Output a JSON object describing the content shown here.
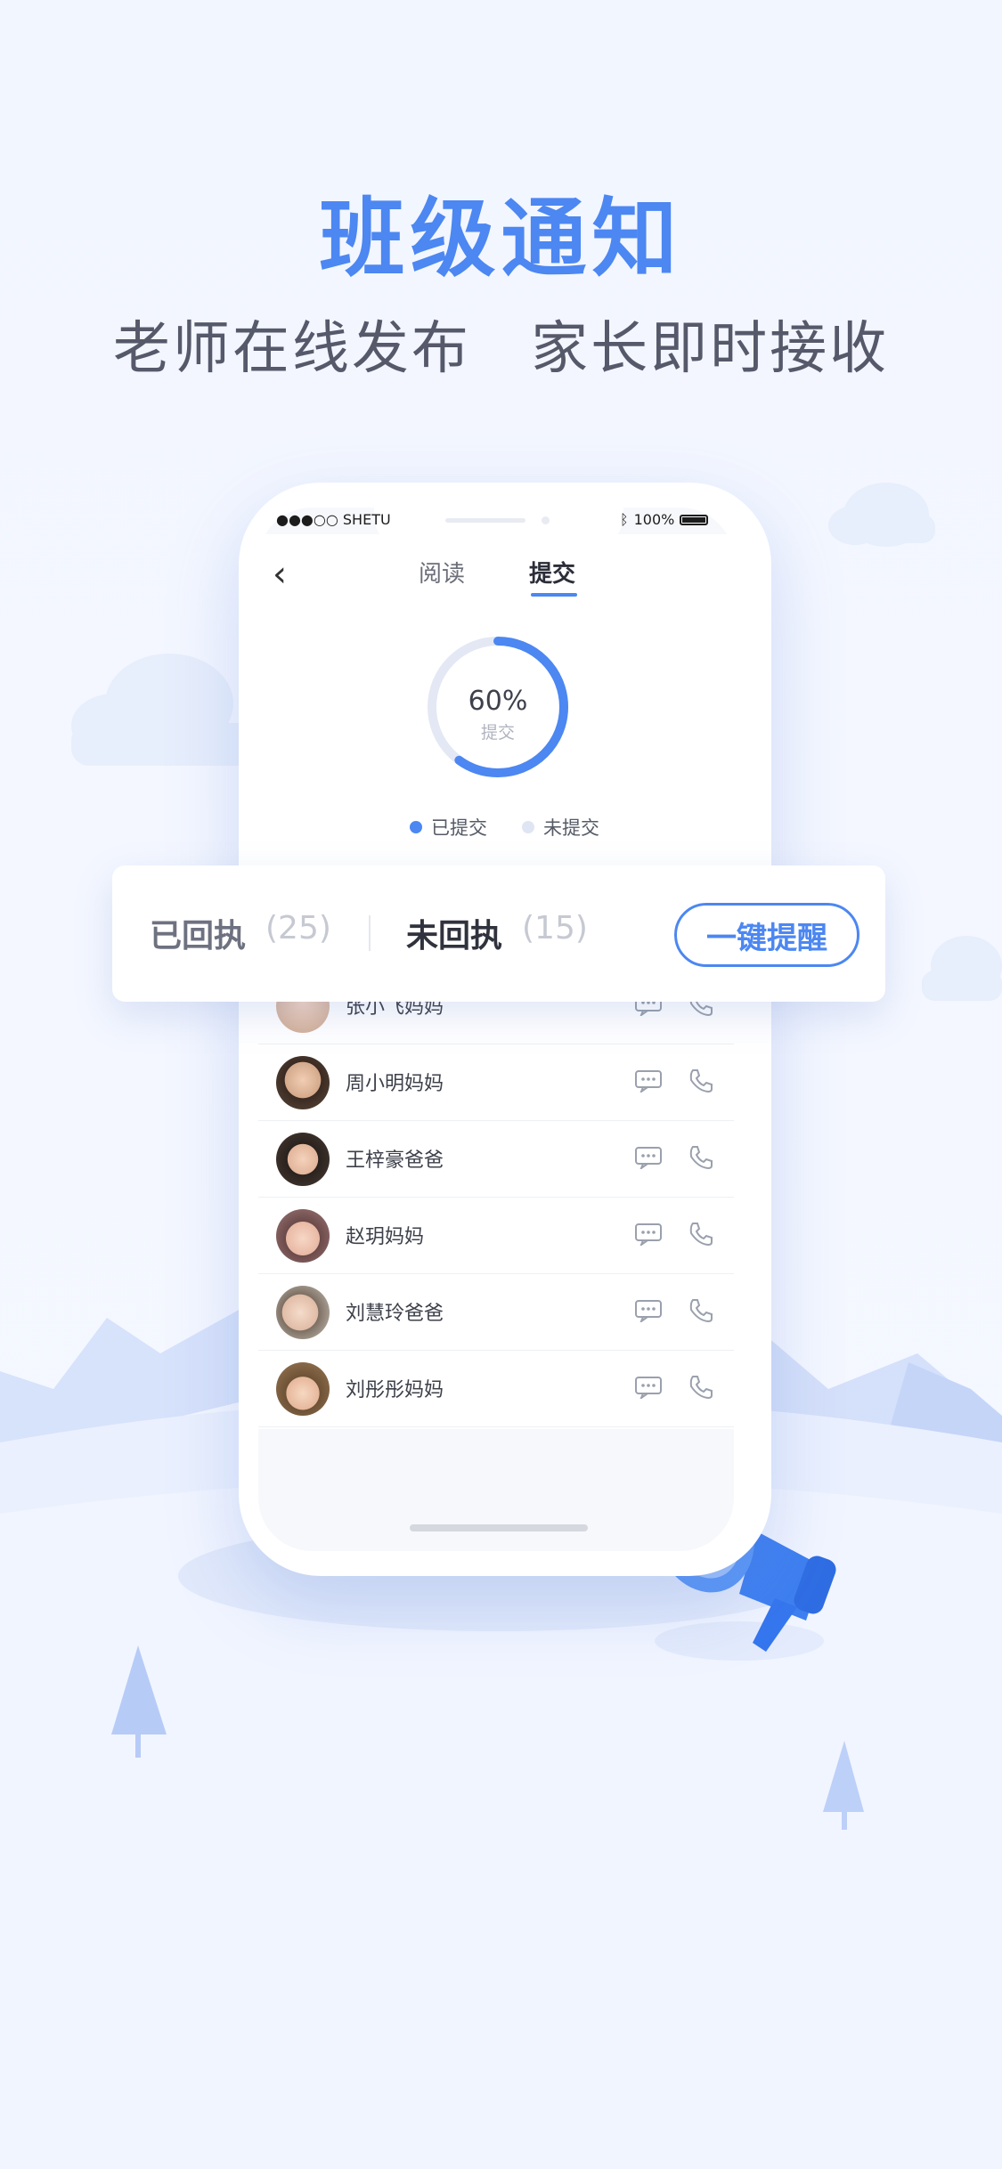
{
  "headline": "班级通知",
  "subline": {
    "left": "老师在线发布",
    "right": "家长即时接收"
  },
  "phone": {
    "status_left": "●●●○○ SHETU",
    "status_right": "100%",
    "tabs": [
      {
        "label": "阅读"
      },
      {
        "label": "提交"
      }
    ],
    "active_tab": "提交",
    "progress": {
      "percent_label": "60%",
      "sub_label": "提交",
      "value": 0.6
    },
    "legend": [
      {
        "label": "已提交",
        "color": "#4c87f2"
      },
      {
        "label": "未提交",
        "color": "#dfe5f3"
      }
    ],
    "list": [
      {
        "name": "张小飞妈妈"
      },
      {
        "name": "周小明妈妈"
      },
      {
        "name": "王梓豪爸爸"
      },
      {
        "name": "赵玥妈妈"
      },
      {
        "name": "刘慧玲爸爸"
      },
      {
        "name": "刘彤彤妈妈"
      }
    ]
  },
  "receipt_card": {
    "returned_label": "已回执",
    "returned_count": "(25)",
    "pending_label": "未回执",
    "pending_count": "(15)",
    "remind_button": "一键提醒"
  },
  "colors": {
    "accent": "#4c87f2",
    "background": "#f3f7ff"
  }
}
